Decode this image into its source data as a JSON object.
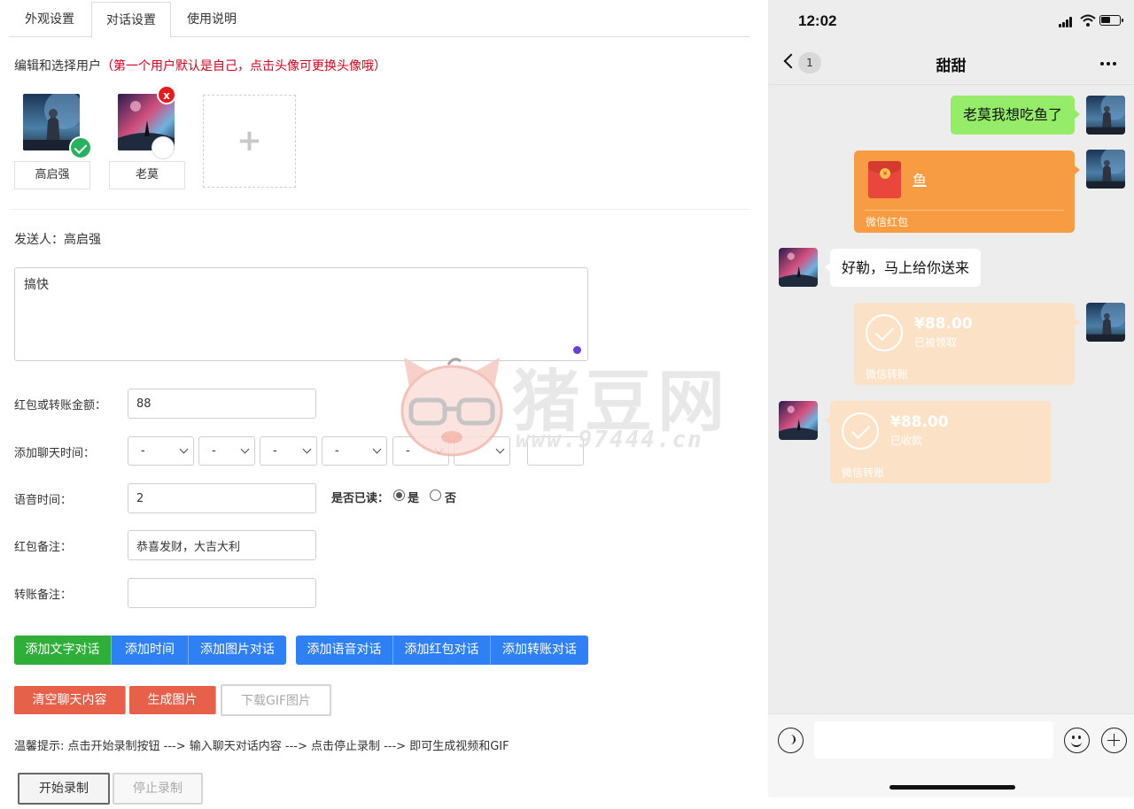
{
  "tabs": [
    "外观设置",
    "对话设置",
    "使用说明"
  ],
  "section": {
    "title": "编辑和选择用户",
    "hint": "（第一个用户默认是自己，点击头像可更换头像哦）"
  },
  "users": [
    {
      "name": "高启强",
      "selected": true
    },
    {
      "name": "老莫",
      "selected": false,
      "remove_label": "x"
    }
  ],
  "add_user_label": "+",
  "sender": {
    "label": "发送人：",
    "name": "高启强"
  },
  "message_text": "搞快",
  "form": {
    "amount_label": "红包或转账金额：",
    "amount_value": "88",
    "time_label": "添加聊天时间：",
    "time_selects": [
      "-",
      "-",
      "-",
      "-",
      "-",
      "",
      ""
    ],
    "voice_label": "语音时间：",
    "voice_value": "2",
    "read_label": "是否已读：",
    "read_yes": "是",
    "read_no": "否",
    "read_selected": "是",
    "rp_note_label": "红包备注：",
    "rp_note_value": "恭喜发财，大吉大利",
    "transfer_note_label": "转账备注：",
    "transfer_note_value": ""
  },
  "buttons": {
    "add_text": "添加文字对话",
    "add_time": "添加时间",
    "add_image": "添加图片对话",
    "add_voice": "添加语音对话",
    "add_redpacket": "添加红包对话",
    "add_transfer": "添加转账对话",
    "clear": "清空聊天内容",
    "generate": "生成图片",
    "download_gif": "下载GIF图片",
    "start_record": "开始录制",
    "stop_record": "停止录制"
  },
  "tip": "温馨提示: 点击开始录制按钮 ---> 输入聊天对话内容 ---> 点击停止录制 ---> 即可生成视频和GIF",
  "watermark": {
    "text": "猪豆网",
    "url": "www.97444.cn"
  },
  "phone": {
    "time": "12:02",
    "unread": "1",
    "title": "甜甜",
    "messages": {
      "m1": "老莫我想吃鱼了",
      "rp_text": "鱼",
      "rp_label": "微信红包",
      "m3": "好勒，马上给你送来",
      "tr1_amount": "¥88.00",
      "tr1_status": "已被领取",
      "tr1_label": "微信转账",
      "tr2_amount": "¥88.00",
      "tr2_status": "已收款",
      "tr2_label": "微信转账"
    }
  },
  "colors": {
    "hint_red": "#d9001b",
    "btn_green": "#2fae3a",
    "btn_blue": "#2f7ff5",
    "btn_red": "#e7604a",
    "bubble_green": "#95ec69",
    "redpacket": "#f79c42",
    "transfer": "#fbe2c6"
  }
}
